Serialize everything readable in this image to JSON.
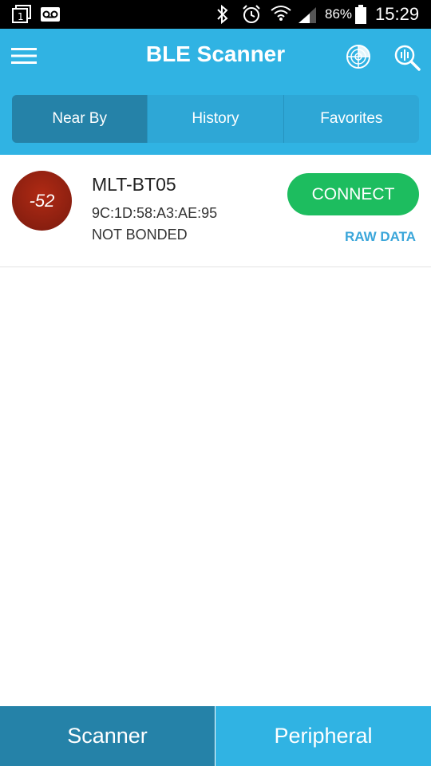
{
  "status_bar": {
    "battery_text": "86%",
    "time": "15:29",
    "icons": [
      "sim-icon",
      "voicemail-icon",
      "bluetooth-icon",
      "alarm-icon",
      "wifi-icon",
      "signal-icon",
      "battery-icon"
    ]
  },
  "app_bar": {
    "title": "BLE Scanner",
    "icons": [
      "menu-icon",
      "radar-icon",
      "search-icon"
    ]
  },
  "tabs": [
    {
      "label": "Near By",
      "active": true
    },
    {
      "label": "History",
      "active": false
    },
    {
      "label": "Favorites",
      "active": false
    }
  ],
  "devices": [
    {
      "rssi": "-52",
      "name": "MLT-BT05",
      "mac": "9C:1D:58:A3:AE:95",
      "bond_state": "NOT BONDED",
      "connect_label": "CONNECT",
      "raw_data_label": "RAW DATA"
    }
  ],
  "bottom_nav": {
    "scanner_label": "Scanner",
    "peripheral_label": "Peripheral"
  },
  "colors": {
    "primary": "#30b3e3",
    "primary_dark": "#2582a8",
    "connect_green": "#1dbd5f",
    "rssi_red": "#8a1f10",
    "link_blue": "#3aa6da"
  }
}
